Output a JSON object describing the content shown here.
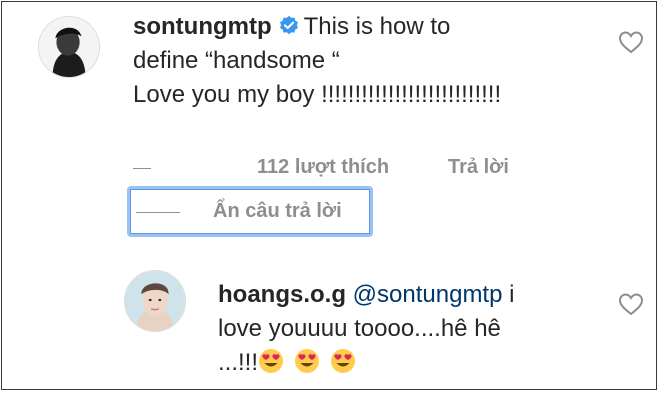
{
  "comment": {
    "username": "sontungmtp",
    "verified": true,
    "text_line1": "This is how to",
    "text_line2": "define “handsome “",
    "text_line3": "Love you my boy !!!!!!!!!!!!!!!!!!!!!!!!!!!",
    "likes_label": "112 lượt thích",
    "reply_label": "Trả lời",
    "hide_replies_label": "Ẩn câu trả lời"
  },
  "reply": {
    "username": "hoangs.o.g",
    "mention": "@sontungmtp",
    "text_line1_tail": " i",
    "text_line2": "love youuuu toooo....hê hê",
    "text_line3": "...!!!",
    "emojis": [
      "heart-eyes-emoji",
      "heart-eyes-emoji",
      "heart-eyes-emoji"
    ]
  },
  "icons": {
    "verified": "verified-badge-icon",
    "like": "heart-outline-icon"
  },
  "colors": {
    "text": "#262626",
    "meta": "#8e8e8e",
    "verified": "#3897f0",
    "mention": "#00376b",
    "focus": "#9cc2f3"
  }
}
